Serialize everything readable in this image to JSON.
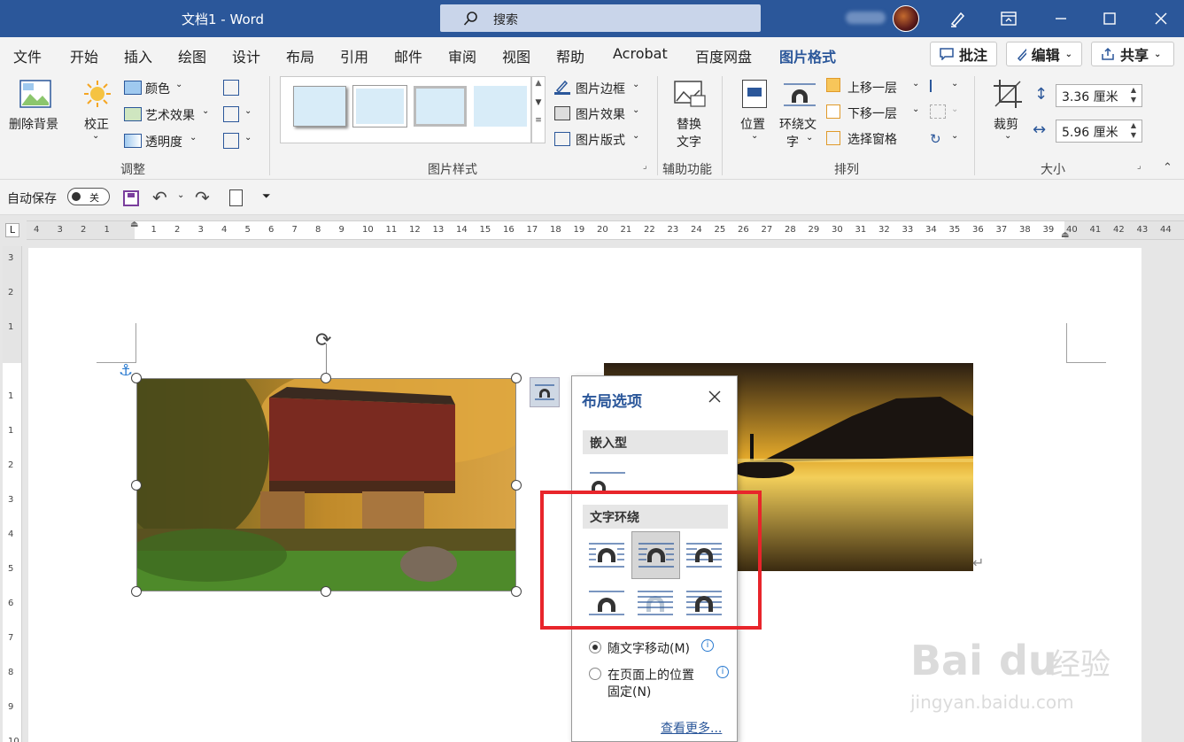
{
  "titlebar": {
    "doc_title": "文档1  -  Word",
    "search_placeholder": "搜索"
  },
  "tabs": [
    "文件",
    "开始",
    "插入",
    "绘图",
    "设计",
    "布局",
    "引用",
    "邮件",
    "审阅",
    "视图",
    "帮助",
    "Acrobat",
    "百度网盘",
    "图片格式"
  ],
  "active_tab": "图片格式",
  "header_buttons": {
    "comment": "批注",
    "edit": "编辑",
    "share": "共享"
  },
  "ribbon": {
    "remove_bg": "删除背景",
    "adjust": {
      "correct": "校正",
      "color": "颜色",
      "art_effects": "艺术效果",
      "transparency": "透明度",
      "group": "调整"
    },
    "picture_styles": {
      "border": "图片边框",
      "effects": "图片效果",
      "layout": "图片版式",
      "group": "图片样式"
    },
    "accessibility": {
      "alt_text_line1": "替换",
      "alt_text_line2": "文字",
      "group": "辅助功能"
    },
    "arrange": {
      "position": "位置",
      "wrap_line1": "环绕文",
      "wrap_line2": "字",
      "bring_forward": "上移一层",
      "send_backward": "下移一层",
      "selection_pane": "选择窗格",
      "group": "排列"
    },
    "size": {
      "crop": "裁剪",
      "height": "3.36 厘米",
      "width": "5.96 厘米",
      "group": "大小"
    }
  },
  "qat": {
    "autosave": "自动保存",
    "toggle_state": "关"
  },
  "ruler": {
    "h_ticks": [
      "4",
      "3",
      "2",
      "1",
      "",
      "1",
      "2",
      "3",
      "4",
      "5",
      "6",
      "7",
      "8",
      "9",
      "10",
      "11",
      "12",
      "13",
      "14",
      "15",
      "16",
      "17",
      "18",
      "19",
      "20",
      "21",
      "22",
      "23",
      "24",
      "25",
      "26",
      "27",
      "28",
      "29",
      "30",
      "31",
      "32",
      "33",
      "34",
      "35",
      "36",
      "37",
      "38",
      "39",
      "40",
      "41",
      "42",
      "43",
      "44"
    ],
    "v_ticks": [
      "3",
      "2",
      "1",
      "",
      "1",
      "1",
      "2",
      "3",
      "4",
      "5",
      "6",
      "7",
      "8",
      "9",
      "10"
    ]
  },
  "layout_popup": {
    "title": "布局选项",
    "inline_section": "嵌入型",
    "wrap_section": "文字环绕",
    "move_with_text": "随文字移动(M)",
    "fix_position_line1": "在页面上的位置",
    "fix_position_line2": "固定(N)",
    "see_more": "查看更多..."
  },
  "colors": {
    "accent": "#2b579a",
    "highlight_box": "#e8252b"
  }
}
